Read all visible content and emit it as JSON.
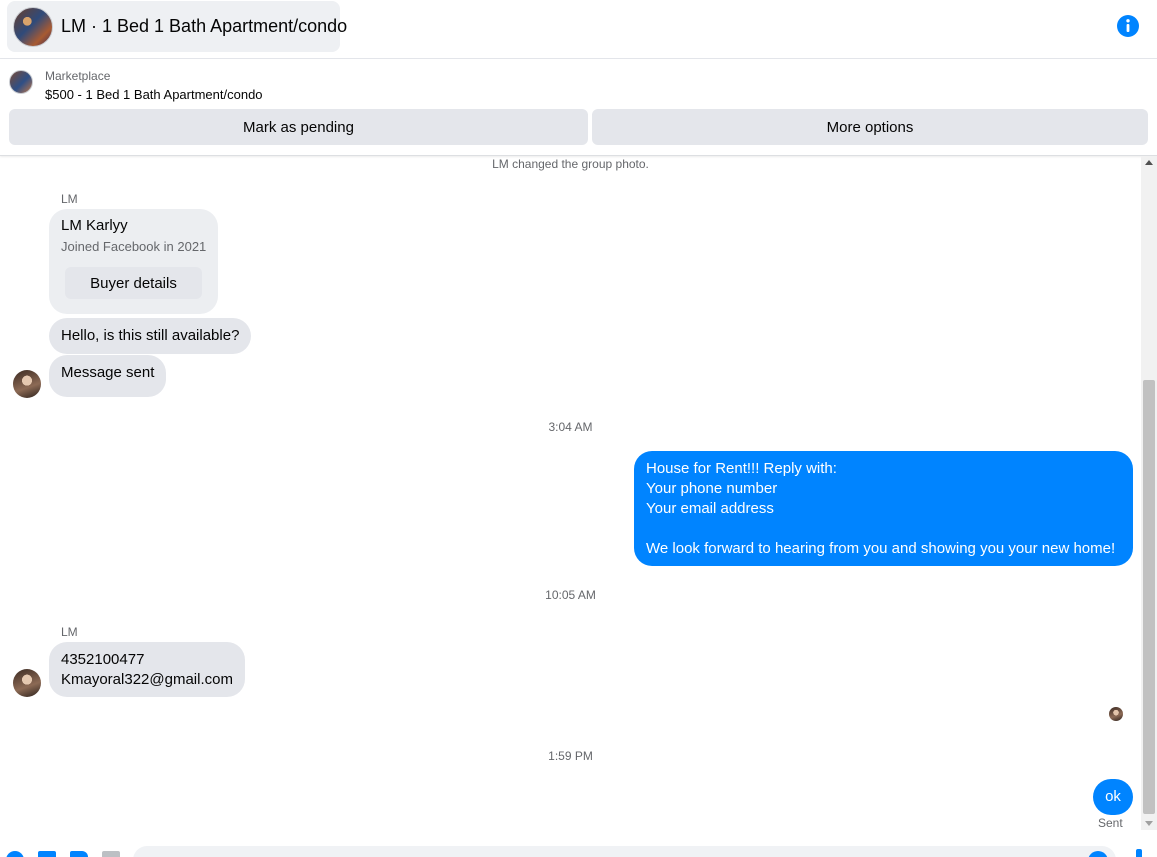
{
  "header": {
    "title": "LM · 1 Bed 1 Bath Apartment/condo",
    "info_icon": "info-icon"
  },
  "marketplace": {
    "label": "Marketplace",
    "listing": "$500 - 1 Bed 1 Bath Apartment/condo",
    "mark_pending_label": "Mark as pending",
    "more_options_label": "More options"
  },
  "thread": {
    "system_note": "LM changed the group photo.",
    "sender_1": "LM",
    "buyer_card": {
      "name": "LM Karlyy",
      "joined": "Joined Facebook in 2021",
      "button_label": "Buyer details"
    },
    "msg_in_1": "Hello, is this still available?",
    "msg_in_2": "Message sent",
    "time_1": "3:04 AM",
    "msg_out_1": {
      "line1": "House for Rent!!! Reply with:",
      "line2": "Your phone number",
      "line3": "Your email address",
      "line4": "We look forward to hearing from you and showing you your new home!"
    },
    "time_2": "10:05 AM",
    "sender_2": "LM",
    "msg_in_3": {
      "line1": "4352100477",
      "line2": "Kmayoral322@gmail.com"
    },
    "time_3": "1:59 PM",
    "msg_out_2": "ok",
    "status": "Sent"
  },
  "colors": {
    "accent": "#0084ff",
    "incoming_bubble": "#e4e6eb",
    "secondary_text": "#65676b"
  }
}
